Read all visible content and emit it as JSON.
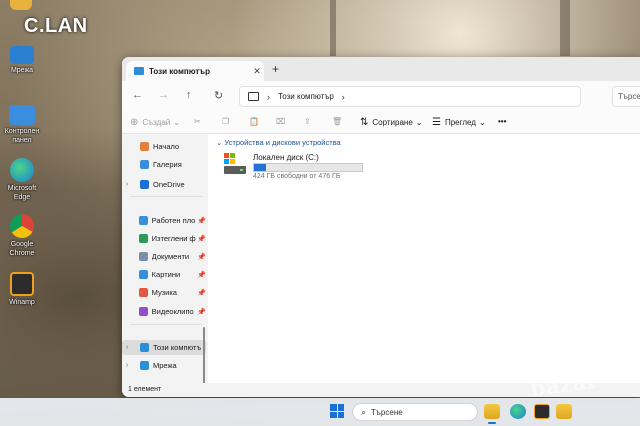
{
  "desktop": {
    "brand": "C.LAN",
    "icons": [
      {
        "label": "Мрежа",
        "icon": "network-icon"
      },
      {
        "label": "Контролен панел",
        "icon": "control-panel-icon"
      },
      {
        "label": "Microsoft Edge",
        "icon": "edge-icon"
      },
      {
        "label": "Google Chrome",
        "icon": "chrome-icon"
      },
      {
        "label": "Winamp",
        "icon": "winamp-icon"
      }
    ]
  },
  "window": {
    "tab_title": "Този компютър",
    "close_glyph": "✕",
    "newtab_glyph": "+",
    "nav": {
      "back": "←",
      "forward": "→",
      "up": "↑",
      "refresh": "↻"
    },
    "address": {
      "separator": "›",
      "location": "Този компютър",
      "trail": "›"
    },
    "search_placeholder": "Търсе",
    "toolbar": {
      "new_label": "Създай",
      "sort_label": "Сортиране",
      "view_label": "Преглед",
      "more": "•••"
    },
    "sidebar": [
      {
        "label": "Начало",
        "color": "#e0803c"
      },
      {
        "label": "Галерия",
        "color": "#3a8edb"
      },
      {
        "label": "OneDrive",
        "color": "#1d6fd8",
        "expand": "›"
      },
      {
        "label": "Работен пло",
        "color": "#3a8edb",
        "pin": "📌"
      },
      {
        "label": "Изтеглени ф",
        "color": "#2a9a58",
        "pin": "📌"
      },
      {
        "label": "Документи",
        "color": "#7a8ea8",
        "pin": "📌"
      },
      {
        "label": "Картини",
        "color": "#3a8edb",
        "pin": "📌"
      },
      {
        "label": "Музика",
        "color": "#e2583e",
        "pin": "📌"
      },
      {
        "label": "Видеоклипо",
        "color": "#8d52c7",
        "pin": "📌"
      },
      {
        "label": "Този компютър",
        "color": "#2a8fd8",
        "expand": "›"
      },
      {
        "label": "Мрежа",
        "color": "#2a8fd8",
        "expand": "›"
      }
    ],
    "content": {
      "group_header": "Устройства и дискови устройства",
      "group_toggle": "⌄",
      "drive": {
        "name": "Локален диск (C:)",
        "free_text": "424 ГБ свободни от 476 ГБ",
        "used_fraction": 0.11,
        "fill_color": "#2472d3"
      }
    },
    "status": "1 елемент"
  },
  "taskbar": {
    "search_placeholder": "Търсене",
    "search_glyph": "⌕",
    "apps": [
      "file-explorer-icon",
      "edge-icon",
      "winamp-icon",
      "file-explorer-icon"
    ]
  },
  "watermark": "bazar"
}
